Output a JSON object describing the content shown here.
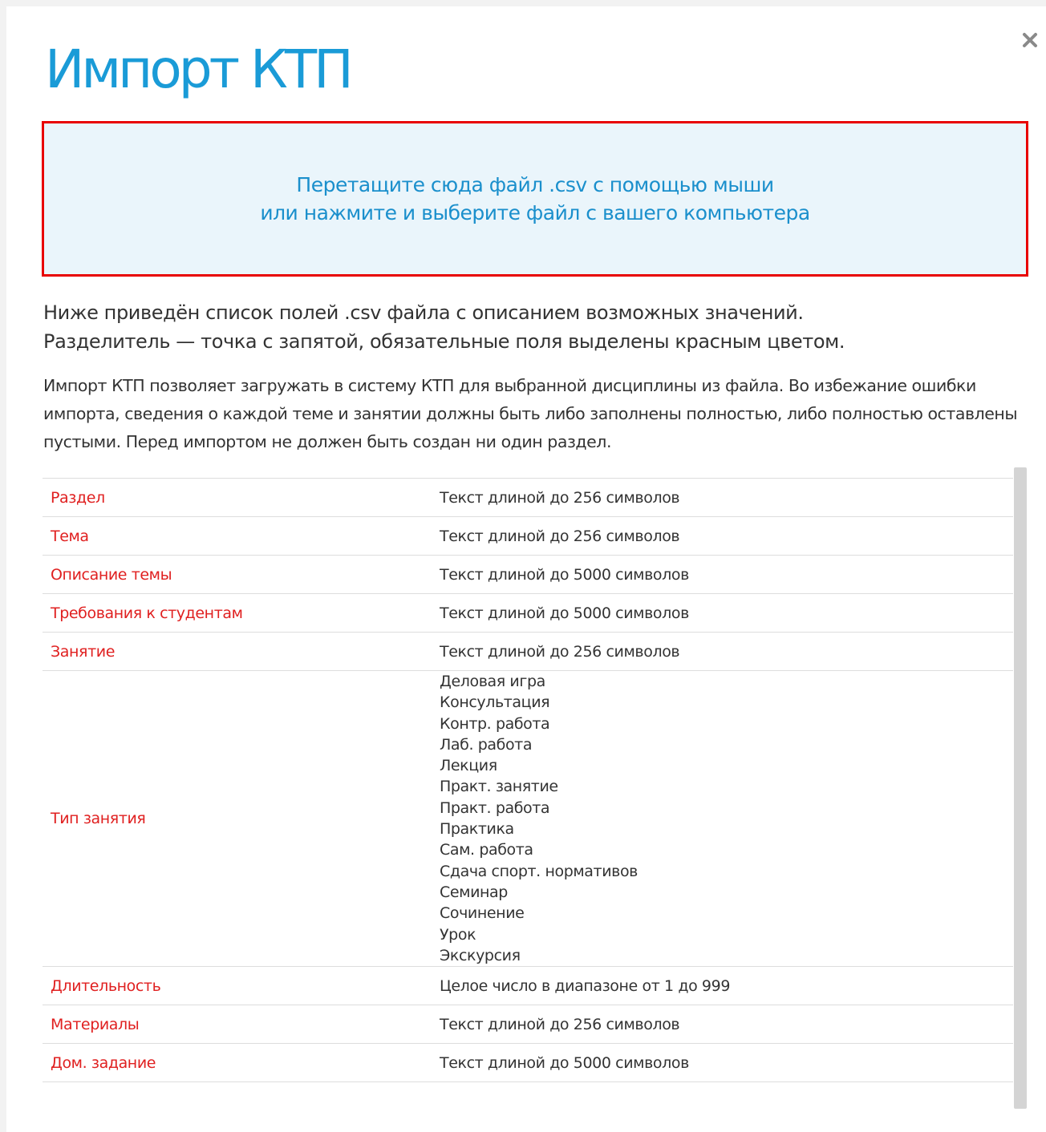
{
  "modal": {
    "title": "Импорт КТП",
    "close_label": "×"
  },
  "dropzone": {
    "line1": "Перетащите сюда файл .csv с помощью мыши",
    "line2": "или нажмите и выберите файл с вашего компьютера"
  },
  "intro": {
    "line1": "Ниже приведён список полей .csv файла с описанием возможных значений.",
    "line2": "Разделитель — точка с запятой, обязательные поля выделены красным цветом."
  },
  "description": "Импорт КТП позволяет загружать в систему КТП для выбранной дисциплины из файла. Во избежание ошибки импорта, сведения о каждой теме и занятии должны быть либо заполнены полностью, либо полностью оставлены пустыми. Перед импортом не должен быть создан ни один раздел.",
  "fields": [
    {
      "name": "Раздел",
      "value": "Текст длиной до 256 символов"
    },
    {
      "name": "Тема",
      "value": "Текст длиной до 256 символов"
    },
    {
      "name": "Описание темы",
      "value": "Текст длиной до 5000 символов"
    },
    {
      "name": "Требования к студентам",
      "value": "Текст длиной до 5000 символов"
    },
    {
      "name": "Занятие",
      "value": "Текст длиной до 256 символов"
    },
    {
      "name": "Тип занятия",
      "options": [
        "Деловая игра",
        "Консультация",
        "Контр. работа",
        "Лаб. работа",
        "Лекция",
        "Практ. занятие",
        "Практ. работа",
        "Практика",
        "Сам. работа",
        "Сдача спорт. нормативов",
        "Семинар",
        "Сочинение",
        "Урок",
        "Экскурсия"
      ]
    },
    {
      "name": "Длительность",
      "value": "Целое число в диапазоне от 1 до 999"
    },
    {
      "name": "Материалы",
      "value": "Текст длиной до 256 символов"
    },
    {
      "name": "Дом. задание",
      "value": "Текст длиной до 5000 символов"
    }
  ],
  "colors": {
    "accent": "#1a9bd7",
    "required_field": "#e02020",
    "dropzone_border": "#e80000",
    "dropzone_bg": "#eaf5fb"
  },
  "icons": {
    "close": "close-icon"
  }
}
